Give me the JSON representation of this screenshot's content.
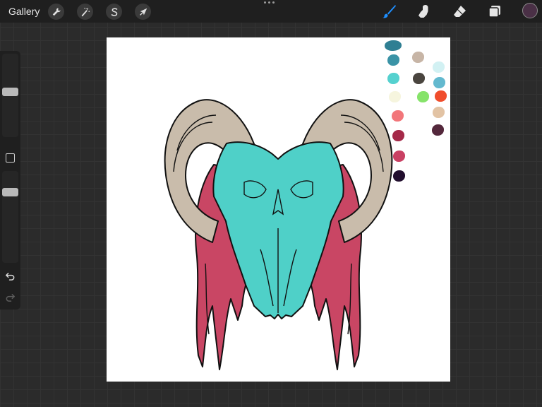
{
  "topbar": {
    "gallery_label": "Gallery",
    "tools": [
      {
        "name": "actions",
        "icon": "wrench-icon"
      },
      {
        "name": "adjustments",
        "icon": "magic-wand-icon"
      },
      {
        "name": "selection",
        "icon": "selection-s-icon"
      },
      {
        "name": "transform",
        "icon": "arrow-cursor-icon"
      }
    ],
    "right_tools": [
      {
        "name": "brush",
        "icon": "paintbrush-icon",
        "active": true
      },
      {
        "name": "smudge",
        "icon": "smudge-finger-icon",
        "active": false
      },
      {
        "name": "eraser",
        "icon": "eraser-icon",
        "active": false
      },
      {
        "name": "layers",
        "icon": "layers-icon",
        "active": false
      }
    ],
    "current_color": "#4a3046",
    "accent_color": "#1e8fff"
  },
  "sidebar": {
    "brush_size_fraction": 0.55,
    "opacity_fraction": 0.8,
    "icons": [
      "modify-square-icon",
      "undo-icon",
      "redo-icon"
    ]
  },
  "palette": [
    "#2f7f93",
    "#c7b5a6",
    "#3a93a6",
    "#d2f1f3",
    "#55d1cf",
    "#4a453f",
    "#63b9cf",
    "#f6f5de",
    "#86e36a",
    "#f04d2c",
    "#f2767a",
    "#e2c3a4",
    "#a52949",
    "#54283c",
    "#c94063",
    "#220f2e"
  ],
  "art_colors": {
    "horn": "#c9bcab",
    "skull": "#4fd0c8",
    "hair": "#c94664",
    "outline": "#111111"
  }
}
